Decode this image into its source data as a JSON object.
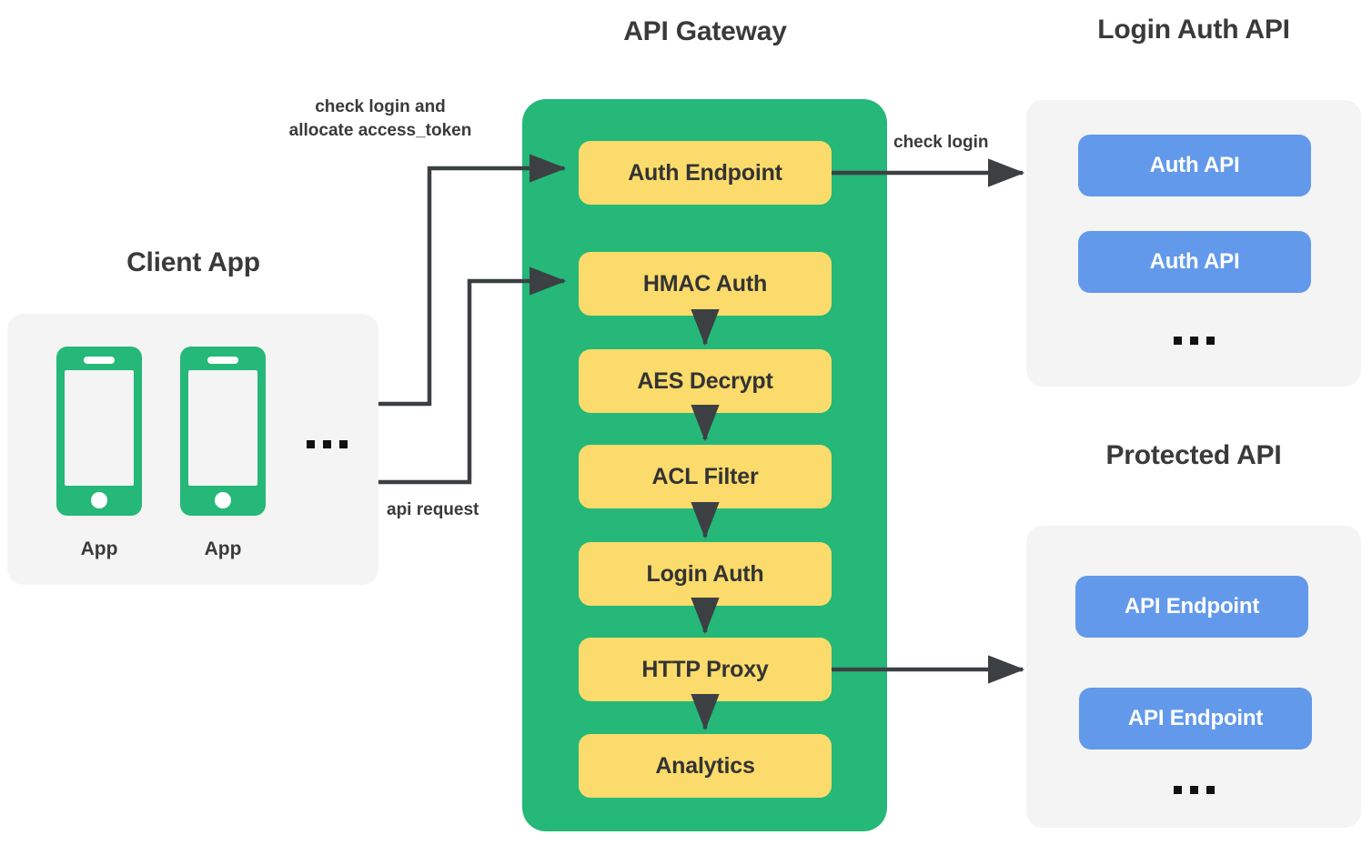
{
  "diagram": {
    "sections": {
      "client_app": {
        "title": "Client App"
      },
      "api_gateway": {
        "title": "API Gateway"
      },
      "login_auth_api": {
        "title": "Login Auth API"
      },
      "protected_api": {
        "title": "Protected API"
      }
    },
    "client_app": {
      "apps": [
        {
          "label": "App",
          "icon": "mobile-phone-icon"
        },
        {
          "label": "App",
          "icon": "mobile-phone-icon"
        }
      ],
      "more_indicator": "..."
    },
    "gateway_stages": [
      {
        "label": "Auth Endpoint"
      },
      {
        "label": "HMAC Auth"
      },
      {
        "label": "AES Decrypt"
      },
      {
        "label": "ACL Filter"
      },
      {
        "label": "Login Auth"
      },
      {
        "label": "HTTP Proxy"
      },
      {
        "label": "Analytics"
      }
    ],
    "login_auth_api": {
      "endpoints": [
        {
          "label": "Auth API"
        },
        {
          "label": "Auth API"
        }
      ],
      "more_indicator": "..."
    },
    "protected_api": {
      "endpoints": [
        {
          "label": "API Endpoint"
        },
        {
          "label": "API Endpoint"
        }
      ],
      "more_indicator": "..."
    },
    "edges": [
      {
        "id": "check-login-allocate",
        "label": "check login and\nallocate access_token",
        "from": "client-app",
        "to": "auth-endpoint"
      },
      {
        "id": "api-request",
        "label": "api request",
        "from": "client-app",
        "to": "hmac-auth"
      },
      {
        "id": "check-login",
        "label": "check login",
        "from": "auth-endpoint",
        "to": "login-auth-api"
      },
      {
        "id": "proxy-to-protected",
        "label": "",
        "from": "http-proxy",
        "to": "protected-api"
      }
    ],
    "colors": {
      "gateway_green": "#25b878",
      "stage_yellow": "#fbdb6b",
      "endpoint_blue": "#6399ea",
      "panel_gray": "#f4f4f4",
      "text_dark": "#3a3a3a",
      "arrow_dark": "#3c4043"
    }
  }
}
